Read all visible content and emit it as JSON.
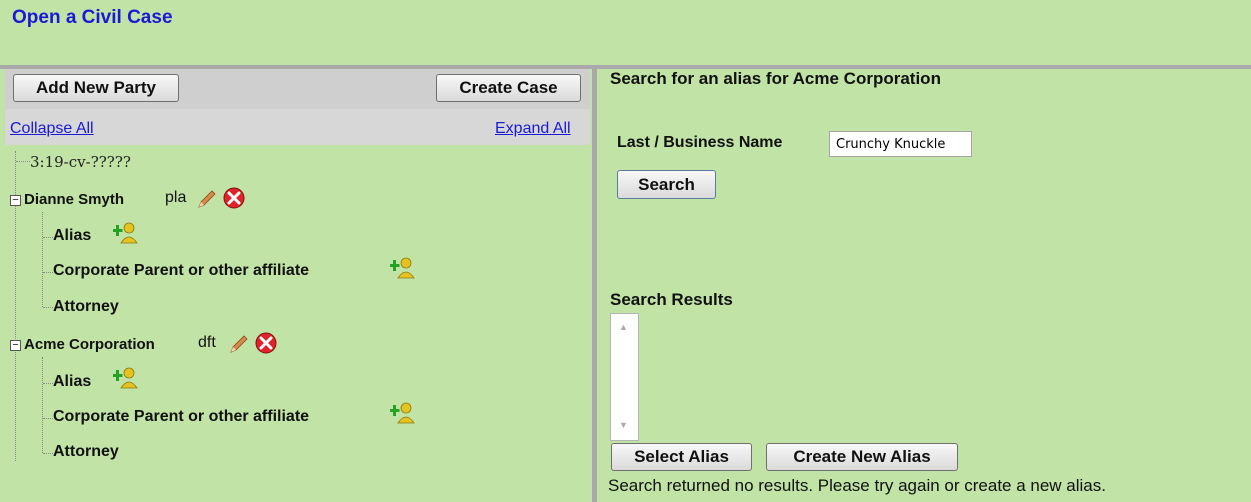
{
  "page": {
    "title": "Open a Civil Case"
  },
  "toolbar": {
    "add_new_party": "Add New Party",
    "create_case": "Create Case",
    "collapse_all": "Collapse All",
    "expand_all": "Expand All"
  },
  "tree": {
    "case_number": "3:19-cv-?????",
    "parties": [
      {
        "name": "Dianne Smyth",
        "role": "pla",
        "children": [
          "Alias",
          "Corporate Parent or other affiliate",
          "Attorney"
        ]
      },
      {
        "name": "Acme Corporation",
        "role": "dft",
        "children": [
          "Alias",
          "Corporate Parent or other affiliate",
          "Attorney"
        ]
      }
    ]
  },
  "search": {
    "heading": "Search for an alias for Acme Corporation",
    "name_label": "Last / Business Name",
    "name_value": "Crunchy Knuckle",
    "search_button": "Search"
  },
  "results": {
    "heading": "Search Results",
    "select_alias": "Select Alias",
    "create_new_alias": "Create New Alias",
    "status": "Search returned no results. Please try again or create a new alias."
  },
  "icons": {
    "edit": "pencil-icon",
    "delete": "delete-x-icon",
    "add_person": "add-person-icon",
    "accent_link": "#1a1ad6",
    "background": "#c1e3a6"
  }
}
